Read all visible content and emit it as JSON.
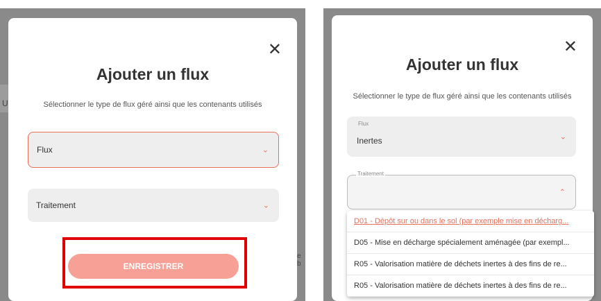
{
  "left": {
    "modal": {
      "title": "Ajouter un flux",
      "subtitle": "Sélectionner le type de flux géré ainsi que les contenants utilisés",
      "close": "✕",
      "flux_field": {
        "value": "Flux"
      },
      "traitement_field": {
        "value": "Traitement"
      },
      "save_label": "ENREGISTRER"
    },
    "peek": {
      "left_char": "U",
      "right_char": "e b"
    }
  },
  "right": {
    "modal": {
      "title": "Ajouter un flux",
      "subtitle": "Sélectionner le type de flux géré ainsi que les contenants utilisés",
      "close": "✕",
      "flux_field": {
        "label": "Flux",
        "value": "Inertes"
      },
      "traitement_field": {
        "label": "Traitement",
        "value": ""
      },
      "options": [
        "D01 - Dépôt sur ou dans le sol (par exemple mise en décharg...",
        "D05 - Mise en décharge spécialement aménagée (par exempl...",
        "R05 - Valorisation matière de déchets inertes à des fins de re...",
        "R05 - Valorisation matière de déchets inertes à des fins de re..."
      ]
    }
  },
  "icons": {
    "chevron_down": "⌄",
    "chevron_up": "⌃"
  },
  "colors": {
    "accent": "#e8705a",
    "button": "#f7a096",
    "highlight": "#e00000"
  }
}
